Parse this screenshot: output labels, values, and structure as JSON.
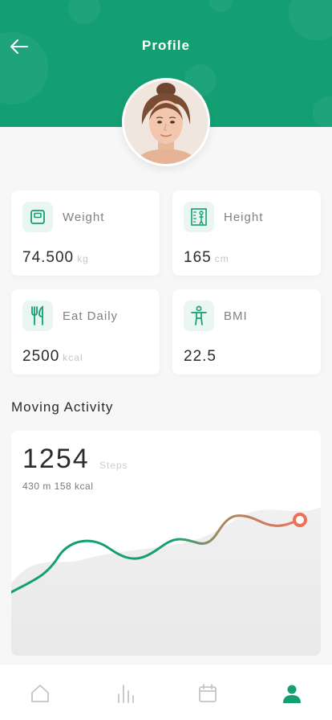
{
  "header": {
    "title": "Profile",
    "back_icon": "arrow-left-icon",
    "color": "#149f73"
  },
  "stats": [
    {
      "label": "Weight",
      "value": "74.500",
      "unit": "kg",
      "icon": "scale-icon"
    },
    {
      "label": "Height",
      "value": "165",
      "unit": "cm",
      "icon": "height-ruler-icon"
    },
    {
      "label": "Eat Daily",
      "value": "2500",
      "unit": "kcal",
      "icon": "fork-knife-icon"
    },
    {
      "label": "BMI",
      "value": "22.5",
      "unit": "",
      "icon": "body-icon"
    }
  ],
  "activity": {
    "section_title": "Moving Activity",
    "steps": "1254",
    "steps_unit": "Steps",
    "subtitle": "430 m 158 kcal",
    "line_colors": [
      "#149f73",
      "#ee7157"
    ]
  },
  "tabbar": {
    "items": [
      "home-icon",
      "stats-icon",
      "calendar-icon",
      "profile-icon"
    ],
    "active": "profile-icon",
    "active_color": "#149f73",
    "inactive_color": "#c4c4c4"
  }
}
